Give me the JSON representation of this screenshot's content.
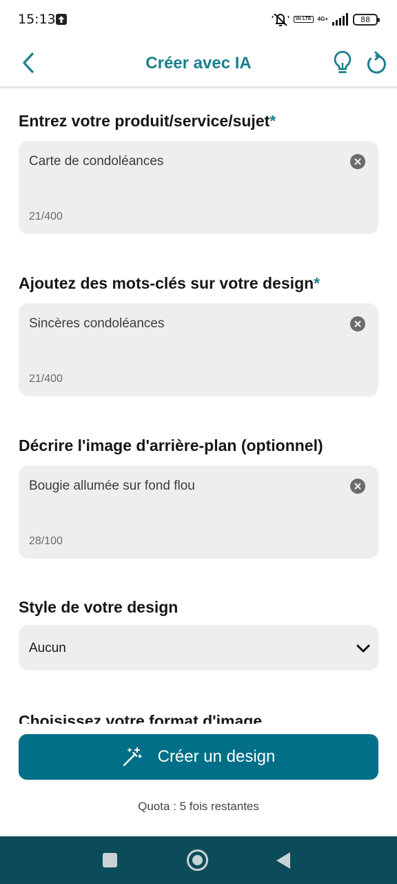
{
  "status_bar": {
    "time": "15:13",
    "network": "4G+",
    "volte": "Vo LTE",
    "battery": "88"
  },
  "header": {
    "title": "Créer avec IA"
  },
  "form": {
    "product": {
      "label": "Entrez votre produit/service/sujet",
      "required_mark": "*",
      "value": "Carte de condoléances",
      "counter": "21/400"
    },
    "keywords": {
      "label": "Ajoutez des mots-clés sur votre design",
      "required_mark": "*",
      "value": "Sincères condoléances",
      "counter": "21/400"
    },
    "background": {
      "label": "Décrire l'image d'arrière-plan (optionnel)",
      "value": "Bougie allumée sur fond flou",
      "counter": "28/100"
    },
    "style": {
      "label": "Style de votre design",
      "selected": "Aucun"
    },
    "format": {
      "label": "Choisissez votre format d'image"
    }
  },
  "actions": {
    "create_label": "Créer un design",
    "quota": "Quota : 5 fois restantes"
  },
  "colors": {
    "accent": "#1a7f8c",
    "button": "#006f87",
    "nav_bar": "#0c4b5a",
    "field_bg": "#eeeeee"
  }
}
